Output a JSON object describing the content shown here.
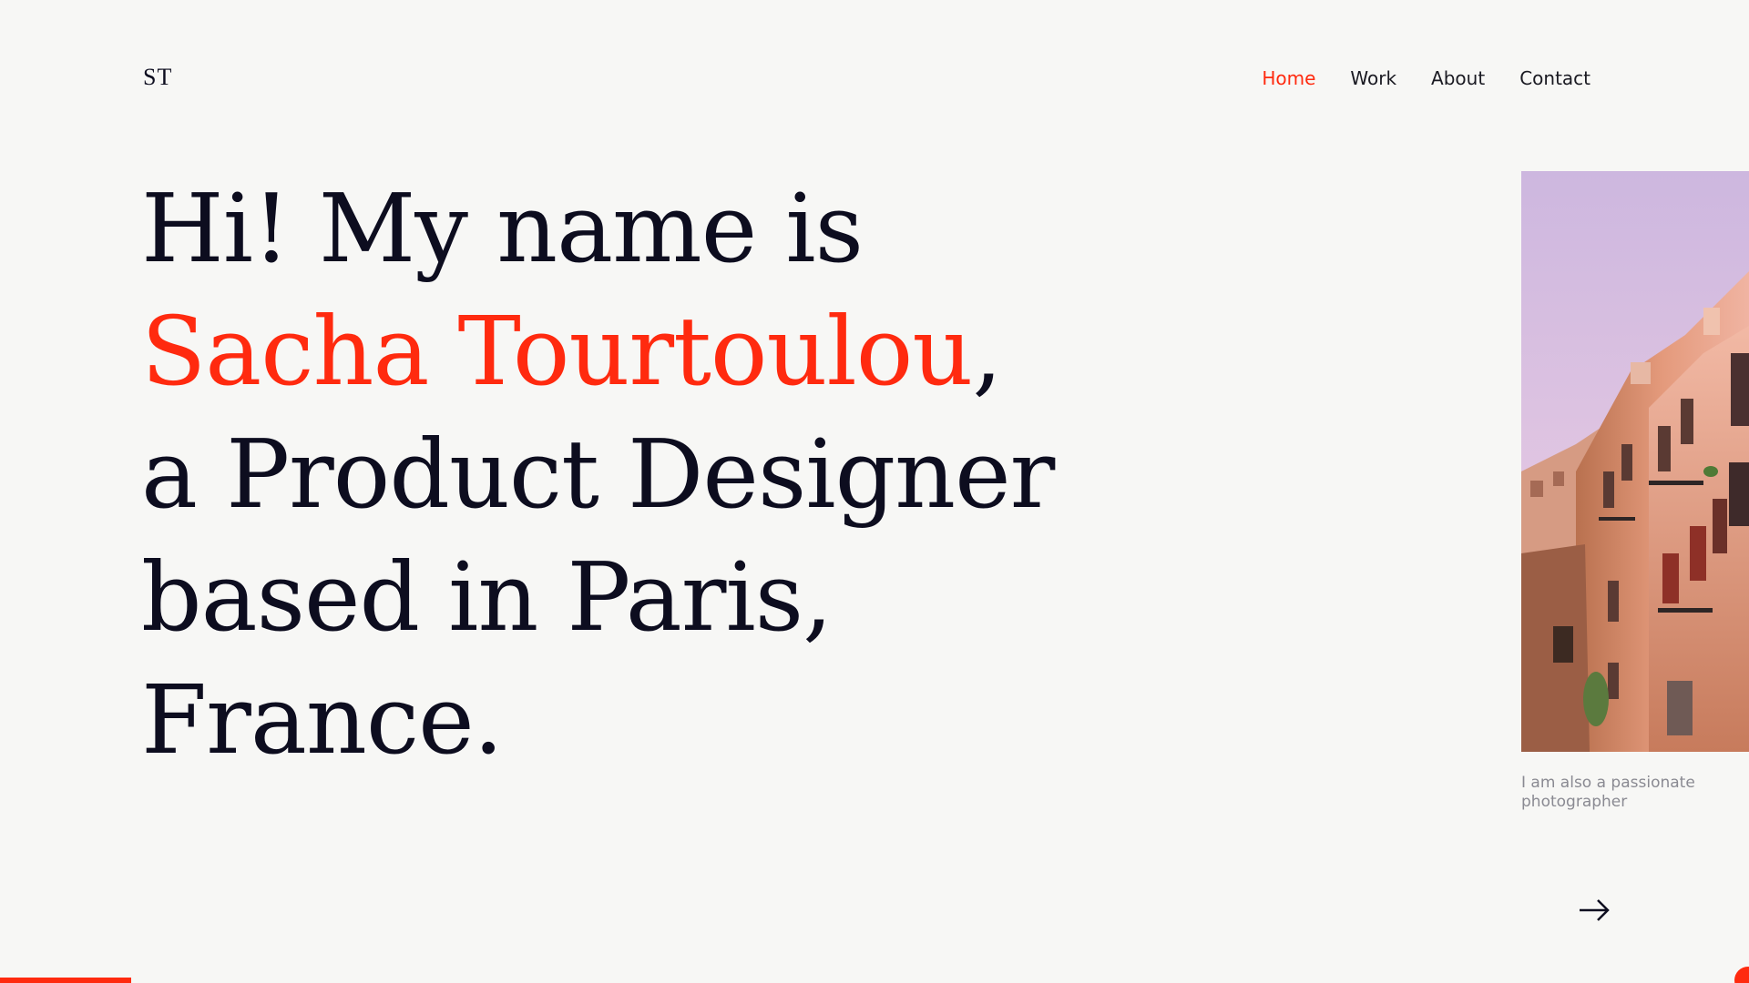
{
  "logo": {
    "text": "ST"
  },
  "nav": {
    "items": [
      {
        "label": "Home",
        "active": true
      },
      {
        "label": "Work",
        "active": false
      },
      {
        "label": "About",
        "active": false
      },
      {
        "label": "Contact",
        "active": false
      }
    ]
  },
  "hero": {
    "line1": "Hi! My name is",
    "name": "Sacha Tourtoulou",
    "name_suffix": ",",
    "line3": "a Product Designer",
    "line4": "based in Paris,",
    "line5": "France."
  },
  "photo": {
    "caption": "I am also a passionate photographer"
  },
  "next_icon": "arrow-right-icon",
  "progress": {
    "value": 0.075
  },
  "colors": {
    "accent": "#ff2a0f",
    "text": "#0d0d1f",
    "background": "#f7f7f5",
    "caption": "#8a8a92"
  }
}
